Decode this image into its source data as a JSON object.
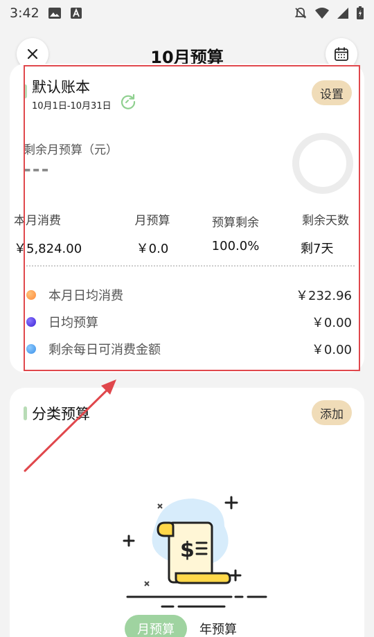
{
  "status_bar": {
    "time": "3:42",
    "icons": [
      "image-icon",
      "a-notification-icon",
      "bell-off-icon",
      "wifi-icon",
      "signal-icon",
      "battery-charging-icon"
    ]
  },
  "header": {
    "title": "10月预算"
  },
  "budget_card": {
    "book_name": "默认账本",
    "date_range": "10月1日-10月31日",
    "settings_label": "设置",
    "remaining_label": "剩余月预算（元）",
    "remaining_value": "---",
    "stats": [
      {
        "label": "本月消费",
        "value": "￥5,824.00"
      },
      {
        "label": "月预算",
        "value": "￥0.0"
      },
      {
        "label": "预算剩余",
        "value": "100.0%"
      },
      {
        "label": "剩余天数",
        "value": "剩7天"
      }
    ],
    "details": [
      {
        "label": "本月日均消费",
        "value": "￥232.96",
        "color": "#ff9a4a"
      },
      {
        "label": "日均预算",
        "value": "￥0.00",
        "color": "#5b3fe6"
      },
      {
        "label": "剩余每日可消费金额",
        "value": "￥0.00",
        "color": "#4aa3f2"
      }
    ]
  },
  "category_card": {
    "title": "分类预算",
    "add_label": "添加",
    "toggle": {
      "month_label": "月预算",
      "year_label": "年预算"
    }
  },
  "colors": {
    "accent_green": "#9fd3a0",
    "pill_bg": "#f0dcb8",
    "annotation_red": "#e0474c"
  }
}
